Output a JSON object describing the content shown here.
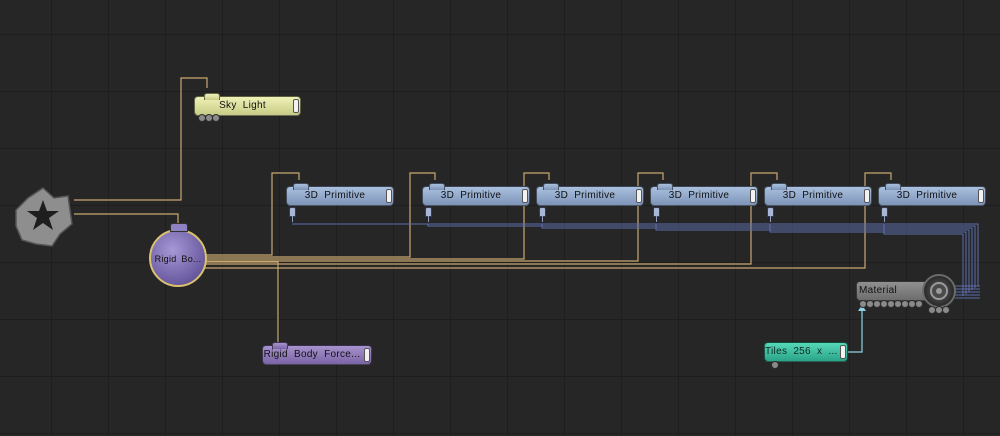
{
  "colors": {
    "background": "#262626",
    "grid": "#1e1e1e",
    "wire_gold": "#c8a870",
    "wire_blue": "#5f6fae",
    "wire_cyan": "#8fd1e6"
  },
  "root": {
    "icon": "star-cog-icon"
  },
  "sky_light": {
    "label": "Sky Light"
  },
  "rigid_body": {
    "label": "Rigid Bo..."
  },
  "rigid_force": {
    "label": "Rigid Body Force..."
  },
  "primitives": [
    {
      "label": "3D Primitive"
    },
    {
      "label": "3D Primitive"
    },
    {
      "label": "3D Primitive"
    },
    {
      "label": "3D Primitive"
    },
    {
      "label": "3D Primitive"
    },
    {
      "label": "3D Primitive"
    }
  ],
  "material": {
    "label": "Material",
    "badge_icon": "material-ball-icon"
  },
  "tiles": {
    "label": "Tiles 256 x ..."
  }
}
